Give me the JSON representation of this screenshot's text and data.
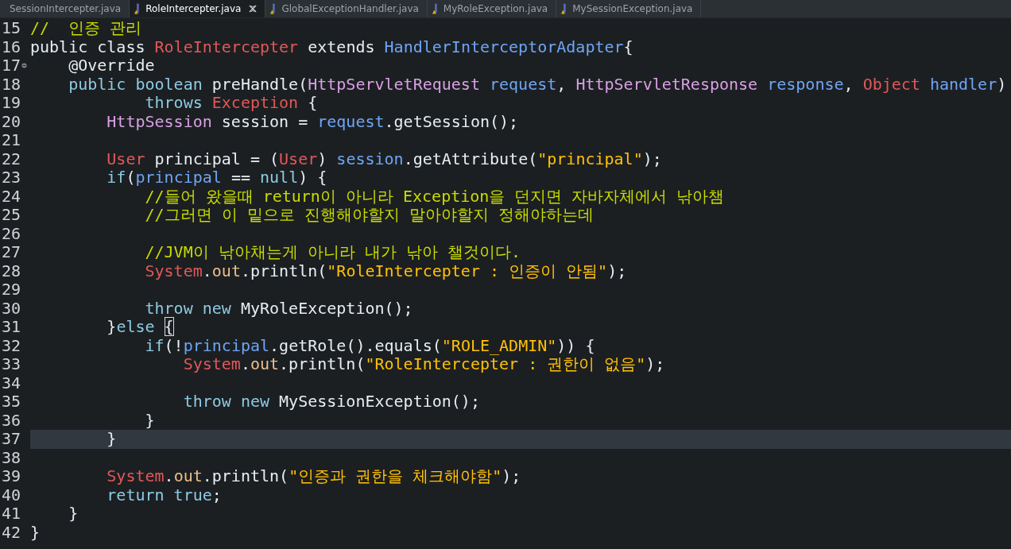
{
  "tabs": [
    {
      "label": "SessionIntercepter.java",
      "selected": false,
      "file_icon": false
    },
    {
      "label": "RoleIntercepter.java",
      "selected": true,
      "file_icon": true
    },
    {
      "label": "GlobalExceptionHandler.java",
      "selected": false,
      "file_icon": true
    },
    {
      "label": "MyRoleException.java",
      "selected": false,
      "file_icon": true
    },
    {
      "label": "MySessionException.java",
      "selected": false,
      "file_icon": true
    }
  ],
  "lines": [
    {
      "number": "15",
      "tokens": [
        {
          "kind": "comment",
          "text": "//  인증 관리"
        }
      ]
    },
    {
      "number": "16",
      "tokens": [
        {
          "kind": "plain",
          "text": "public class "
        },
        {
          "kind": "class",
          "text": "RoleIntercepter"
        },
        {
          "kind": "plain",
          "text": " extends "
        },
        {
          "kind": "variable",
          "text": "HandlerInterceptorAdapter"
        },
        {
          "kind": "plain",
          "text": "{"
        }
      ]
    },
    {
      "number": "17",
      "fold": true,
      "tokens": [
        {
          "kind": "plain",
          "text": "    @Override"
        }
      ]
    },
    {
      "number": "18",
      "tokens": [
        {
          "kind": "keyword",
          "text": "    public boolean"
        },
        {
          "kind": "plain",
          "text": " preHandle("
        },
        {
          "kind": "type",
          "text": "HttpServletRequest"
        },
        {
          "kind": "variable",
          "text": " request"
        },
        {
          "kind": "plain",
          "text": ", "
        },
        {
          "kind": "type",
          "text": "HttpServletResponse"
        },
        {
          "kind": "variable",
          "text": " response"
        },
        {
          "kind": "plain",
          "text": ", "
        },
        {
          "kind": "class",
          "text": "Object"
        },
        {
          "kind": "variable",
          "text": " handler"
        },
        {
          "kind": "plain",
          "text": ")"
        }
      ]
    },
    {
      "number": "19",
      "tokens": [
        {
          "kind": "keyword",
          "text": "            throws"
        },
        {
          "kind": "class",
          "text": " Exception"
        },
        {
          "kind": "plain",
          "text": " {"
        }
      ]
    },
    {
      "number": "20",
      "tokens": [
        {
          "kind": "type",
          "text": "        HttpSession"
        },
        {
          "kind": "plain",
          "text": " session = "
        },
        {
          "kind": "variable",
          "text": "request"
        },
        {
          "kind": "plain",
          "text": ".getSession();"
        }
      ]
    },
    {
      "number": "21"
    },
    {
      "number": "22",
      "tokens": [
        {
          "kind": "class",
          "text": "        User"
        },
        {
          "kind": "plain",
          "text": " principal = ("
        },
        {
          "kind": "class",
          "text": "User"
        },
        {
          "kind": "plain",
          "text": ") "
        },
        {
          "kind": "variable",
          "text": "session"
        },
        {
          "kind": "plain",
          "text": ".getAttribute("
        },
        {
          "kind": "string",
          "text": "\"principal\""
        },
        {
          "kind": "plain",
          "text": ");"
        }
      ]
    },
    {
      "number": "23",
      "tokens": [
        {
          "kind": "keyword",
          "text": "        if"
        },
        {
          "kind": "plain",
          "text": "("
        },
        {
          "kind": "variable",
          "text": "principal"
        },
        {
          "kind": "plain",
          "text": " == "
        },
        {
          "kind": "keyword",
          "text": "null"
        },
        {
          "kind": "plain",
          "text": ") {"
        }
      ]
    },
    {
      "number": "24",
      "tokens": [
        {
          "kind": "comment",
          "text": "            //들어 왔을때 return이 아니라 Exception을 던지면 자바자체에서 낚아챔"
        }
      ]
    },
    {
      "number": "25",
      "tokens": [
        {
          "kind": "comment",
          "text": "            //그러면 이 밑으로 진행해야할지 말아야할지 정해야하는데"
        }
      ]
    },
    {
      "number": "26"
    },
    {
      "number": "27",
      "tokens": [
        {
          "kind": "comment",
          "text": "            //JVM이 낚아채는게 아니라 내가 낚아 챌것이다."
        }
      ]
    },
    {
      "number": "28",
      "tokens": [
        {
          "kind": "class",
          "text": "            System"
        },
        {
          "kind": "plain",
          "text": "."
        },
        {
          "kind": "field",
          "text": "out"
        },
        {
          "kind": "plain",
          "text": ".println("
        },
        {
          "kind": "string",
          "text": "\"RoleIntercepter : 인증이 안됨\""
        },
        {
          "kind": "plain",
          "text": ");"
        }
      ]
    },
    {
      "number": "29"
    },
    {
      "number": "30",
      "tokens": [
        {
          "kind": "keyword",
          "text": "            throw new"
        },
        {
          "kind": "plain",
          "text": " MyRoleException();"
        }
      ]
    },
    {
      "number": "31",
      "tokens": [
        {
          "kind": "plain",
          "text": "        }"
        },
        {
          "kind": "keyword",
          "text": "else"
        },
        {
          "kind": "match",
          "text": "{"
        }
      ]
    },
    {
      "number": "32",
      "tokens": [
        {
          "kind": "keyword",
          "text": "            if"
        },
        {
          "kind": "plain",
          "text": "(!"
        },
        {
          "kind": "variable",
          "text": "principal"
        },
        {
          "kind": "plain",
          "text": ".getRole().equals("
        },
        {
          "kind": "string",
          "text": "\"ROLE_ADMIN\""
        },
        {
          "kind": "plain",
          "text": ")) {"
        }
      ]
    },
    {
      "number": "33",
      "tokens": [
        {
          "kind": "class",
          "text": "                System"
        },
        {
          "kind": "plain",
          "text": "."
        },
        {
          "kind": "field",
          "text": "out"
        },
        {
          "kind": "plain",
          "text": ".println("
        },
        {
          "kind": "string",
          "text": "\"RoleIntercepter : 권한이 없음\""
        },
        {
          "kind": "plain",
          "text": ");"
        }
      ]
    },
    {
      "number": "34"
    },
    {
      "number": "35",
      "tokens": [
        {
          "kind": "keyword",
          "text": "                throw new"
        },
        {
          "kind": "plain",
          "text": " MySessionException();"
        }
      ]
    },
    {
      "number": "36",
      "tokens": [
        {
          "kind": "plain",
          "text": "            }"
        }
      ]
    },
    {
      "number": "37",
      "current": true,
      "tokens": [
        {
          "kind": "plain",
          "text": "        }"
        }
      ]
    },
    {
      "number": "38"
    },
    {
      "number": "39",
      "tokens": [
        {
          "kind": "class",
          "text": "        System"
        },
        {
          "kind": "plain",
          "text": "."
        },
        {
          "kind": "field",
          "text": "out"
        },
        {
          "kind": "plain",
          "text": ".println("
        },
        {
          "kind": "string",
          "text": "\"인증과 권한을 체크해야함\""
        },
        {
          "kind": "plain",
          "text": ");"
        }
      ]
    },
    {
      "number": "40",
      "tokens": [
        {
          "kind": "keyword",
          "text": "        return true"
        },
        {
          "kind": "plain",
          "text": ";"
        }
      ]
    },
    {
      "number": "41",
      "tokens": [
        {
          "kind": "plain",
          "text": "    }"
        }
      ]
    },
    {
      "number": "42",
      "tokens": [
        {
          "kind": "plain",
          "text": "}"
        }
      ]
    }
  ]
}
